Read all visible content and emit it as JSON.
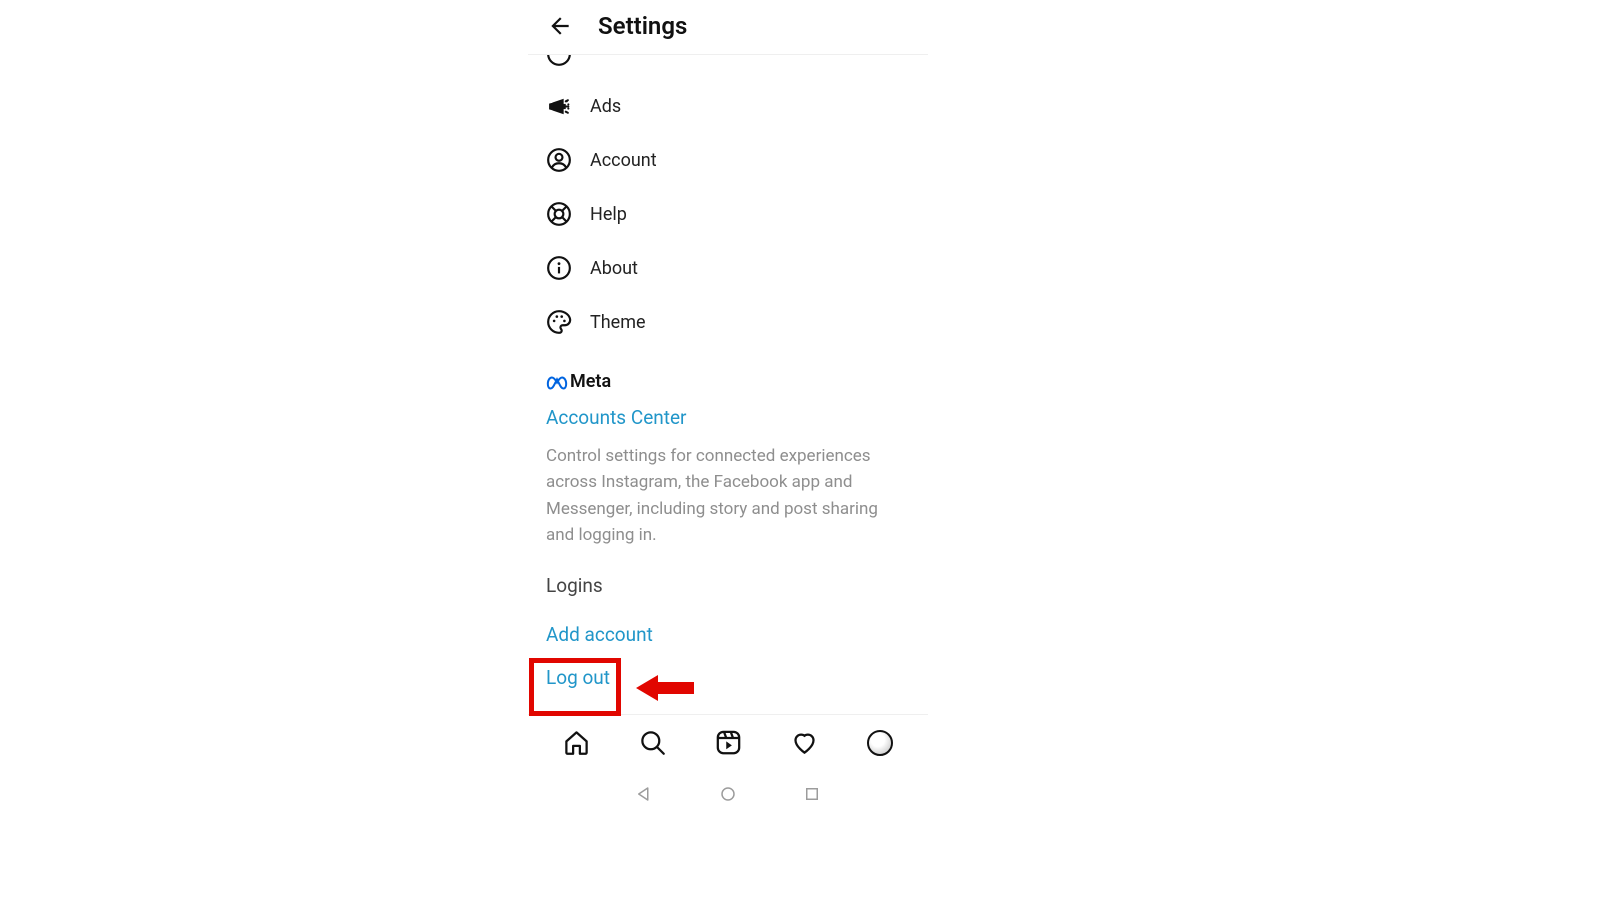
{
  "header": {
    "title": "Settings"
  },
  "items": {
    "ads": "Ads",
    "account": "Account",
    "help": "Help",
    "about": "About",
    "theme": "Theme"
  },
  "meta": {
    "brand": "Meta",
    "accounts_center": "Accounts Center",
    "description": "Control settings for connected experiences across Instagram, the Facebook app and Messenger, including story and post sharing and logging in."
  },
  "logins": {
    "title": "Logins",
    "add_account": "Add account",
    "log_out": "Log out"
  },
  "colors": {
    "link": "#2196c9",
    "annotation": "#e10600"
  }
}
